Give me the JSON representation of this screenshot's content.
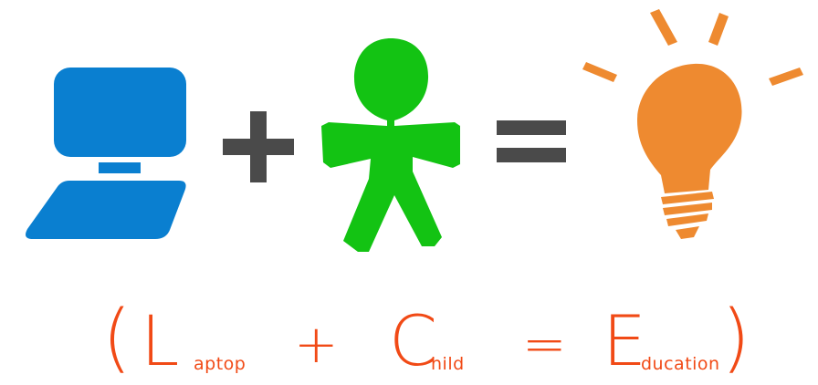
{
  "icons": {
    "laptop": "laptop-icon",
    "plus": "plus-icon",
    "child": "child-figure-icon",
    "equals": "equals-icon",
    "bulb": "light-bulb-icon"
  },
  "colors": {
    "laptop": "#0a7fd0",
    "operator": "#4a4a4a",
    "child": "#13c313",
    "bulb": "#ee8a30",
    "caption": "#f14a16"
  },
  "caption": {
    "open_paren": "(",
    "l_initial": "L",
    "l_rest": "aptop",
    "plus": "+",
    "c_initial": "C",
    "c_rest": "hild",
    "equals": "=",
    "e_initial": "E",
    "e_rest": "ducation",
    "close_paren": ")"
  }
}
